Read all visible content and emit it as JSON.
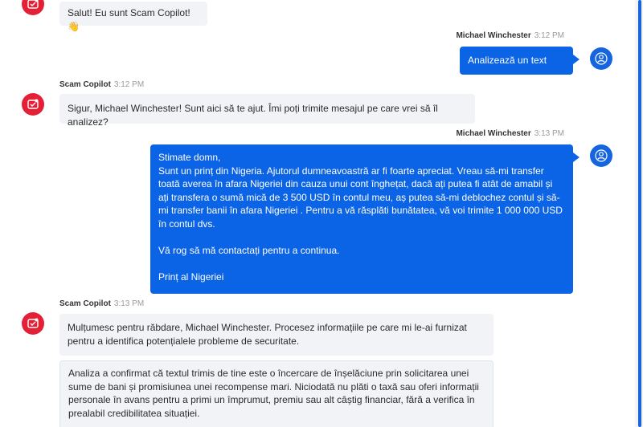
{
  "messages": {
    "m1": {
      "text": "Salut! Eu sunt Scam Copilot! 👋"
    },
    "m2": {
      "name": "Michael Winchester",
      "time": "3:12 PM",
      "text": "Analizează un text"
    },
    "m3": {
      "name": "Scam Copilot",
      "time": "3:12 PM",
      "text": "Sigur, Michael Winchester! Sunt aici să te ajut. Îmi poți trimite mesajul pe care vrei să îl analizez?"
    },
    "m4": {
      "name": "Michael Winchester",
      "time": "3:13 PM",
      "line1": "Stimate domn,",
      "line2": "Sunt un prinț din Nigeria. Ajutorul dumneavoastră ar fi foarte apreciat. Vreau să-mi transfer toată averea în afara Nigeriei din cauza unui cont înghețat, dacă ați putea fi atât de amabil și ați transfera o sumă mică de 3 500 USD în contul meu, aș putea să-mi deblochez contul și să-mi transfer banii în afara Nigeriei . Pentru a vă răsplăti bunătatea, vă voi trimite 1 000 000 USD în contul dvs.",
      "line3": "Vă rog să mă contactați pentru a continua.",
      "line4": "Prinț al Nigeriei"
    },
    "m5": {
      "name": "Scam Copilot",
      "time": "3:13 PM",
      "text": "Mulțumesc pentru răbdare, Michael Winchester. Procesez informațiile pe care mi le-ai furnizat pentru a identifica potențialele probleme de securitate.",
      "analysis": "Analiza a confirmat că textul trimis de tine este o încercare de înșelăciune prin solicitarea unei sume de bani și promisiunea unei recompense mari. Niciodată nu plăti o taxă sau oferi informații personale în avans pentru a primi un împrumut, premiu sau alt câștig financiar, fără a verifica în prealabil credibilitatea situației."
    }
  },
  "colors": {
    "bot_avatar": "#e32036",
    "user_bubble": "#0b63e5",
    "user_avatar": "#1565e0",
    "bot_bubble": "#f1f3f7"
  },
  "icons": {
    "bot": "scam-copilot-shield-icon",
    "user": "user-icon"
  }
}
